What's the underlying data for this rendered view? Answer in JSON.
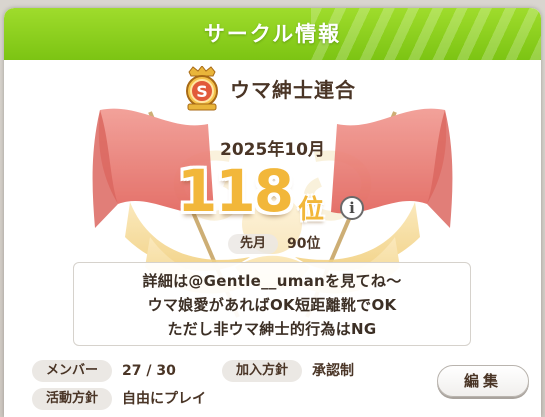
{
  "header": {
    "title": "サークル情報"
  },
  "circle": {
    "badge_letter": "S",
    "name": "ウマ紳士連合",
    "period": "2025年10月",
    "rank_number": "118",
    "rank_unit": "位",
    "info_icon_glyph": "i",
    "last_month_label": "先月",
    "last_month_value": "90位"
  },
  "description": {
    "lines": [
      "詳細は@Gentle__umanを見てね～",
      "ウマ娘愛があればOK短距離靴でOK",
      "ただし非ウマ紳士的行為はNG"
    ]
  },
  "details": {
    "member_label": "メンバー",
    "member_value": "27 / 30",
    "join_label": "加入方針",
    "join_value": "承認制",
    "activity_label": "活動方針",
    "activity_value": "自由にプレイ"
  },
  "actions": {
    "edit_label": "編集"
  },
  "colors": {
    "header_green": "#8fd21f",
    "rank_gold": "#f2b73a",
    "flag_red": "#e8736d",
    "text_brown": "#4a3526"
  },
  "icons": {
    "badge": "gold-shield-badge-icon",
    "info": "info-icon"
  }
}
